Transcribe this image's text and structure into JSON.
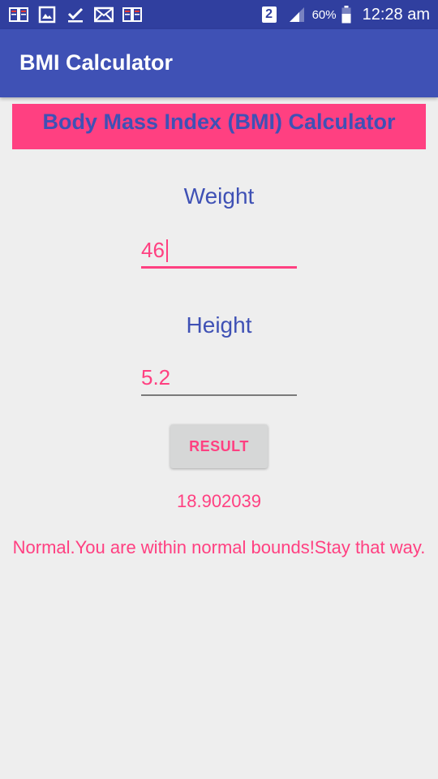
{
  "status_bar": {
    "notification_icons": [
      "book-icon",
      "image-icon",
      "check-icon",
      "mail-icon",
      "book-icon"
    ],
    "sim_slot": "2",
    "battery_percent": "60%",
    "time": "12:28 am"
  },
  "app_bar": {
    "title": "BMI Calculator"
  },
  "main": {
    "banner_title": "Body Mass Index (BMI) Calculator",
    "weight": {
      "label": "Weight",
      "value": "46"
    },
    "height": {
      "label": "Height",
      "value": "5.2"
    },
    "result_button_label": "RESULT",
    "bmi_value": "18.902039",
    "bmi_message": "Normal.You are within normal bounds!Stay that way."
  },
  "colors": {
    "primary": "#3F51B5",
    "primary_dark": "#303F9F",
    "accent": "#FF4081",
    "background": "#EEEEEE"
  }
}
